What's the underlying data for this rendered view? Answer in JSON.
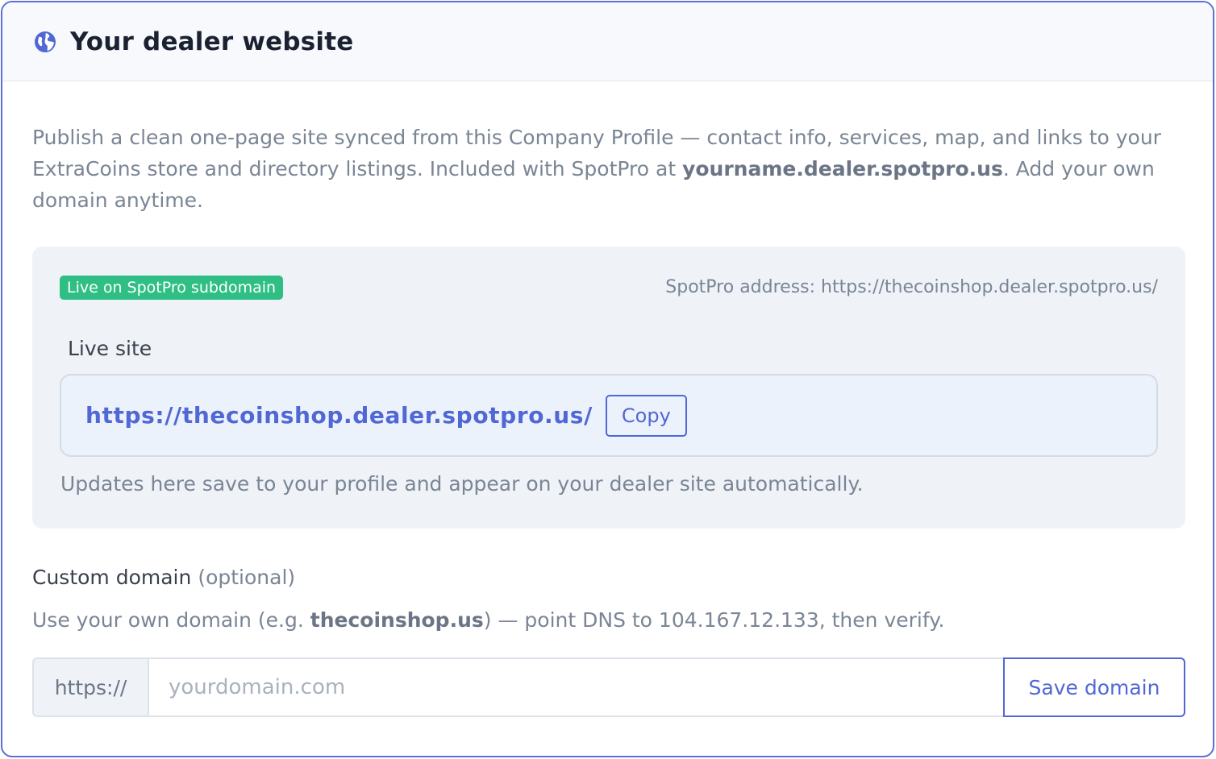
{
  "header": {
    "title": "Your dealer website",
    "icon": "globe-icon"
  },
  "intro": {
    "before": "Publish a clean one-page site synced from this Company Profile — contact info, services, map, and links to your ExtraCoins store and directory listings. Included with SpotPro at ",
    "highlight": "yourname.dealer.spotpro.us",
    "after": ". Add your own domain anytime."
  },
  "status": {
    "badge": "Live on SpotPro subdomain",
    "badge_color": "#2fbf85",
    "address": "SpotPro address: https://thecoinshop.dealer.spotpro.us/",
    "live_label": "Live site",
    "live_url": "https://thecoinshop.dealer.spotpro.us/",
    "copy_label": "Copy",
    "note": "Updates here save to your profile and appear on your dealer site automatically."
  },
  "custom_domain": {
    "heading": "Custom domain",
    "optional": "(optional)",
    "help_before": "Use your own domain (e.g. ",
    "help_example": "thecoinshop.us",
    "help_after": ") — point DNS to 104.167.12.133, then verify.",
    "prefix": "https://",
    "placeholder": "yourdomain.com",
    "value": "",
    "save_label": "Save domain"
  },
  "colors": {
    "accent": "#5168d4",
    "border": "#5a6fd8"
  }
}
